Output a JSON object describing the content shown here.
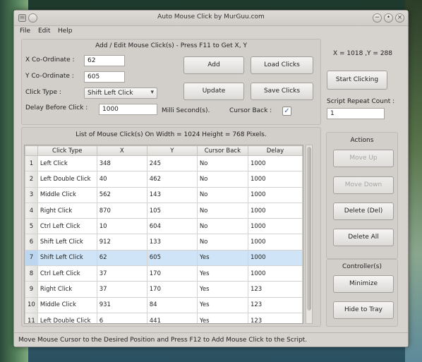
{
  "window": {
    "title": "Auto Mouse Click by MurGuu.com",
    "controls": [
      "−",
      "•",
      "×"
    ]
  },
  "menu": [
    "File",
    "Edit",
    "Help"
  ],
  "editor": {
    "heading": "Add / Edit Mouse Click(s) - Press F11 to Get X, Y",
    "x_label": "X Co-Ordinate :",
    "x_value": "62",
    "y_label": "Y Co-Ordinate :",
    "y_value": "605",
    "click_type_label": "Click Type :",
    "click_type_value": "Shift Left Click",
    "delay_label": "Delay Before Click :",
    "delay_value": "1000",
    "delay_unit": "Milli Second(s).",
    "cursor_back_label": "Cursor Back :",
    "cursor_back_checked": true,
    "buttons": {
      "add": "Add",
      "update": "Update",
      "load": "Load Clicks",
      "save": "Save Clicks"
    }
  },
  "right": {
    "coords": "X = 1018 ,Y = 288",
    "start": "Start Clicking",
    "repeat_label": "Script Repeat Count :",
    "repeat_value": "1"
  },
  "list": {
    "heading": "List of Mouse Click(s) On Width = 1024 Height = 768 Pixels.",
    "columns": [
      "Click Type",
      "X",
      "Y",
      "Cursor Back",
      "Delay"
    ],
    "selected_row": 7,
    "rows": [
      [
        "1",
        "Left Click",
        "348",
        "245",
        "No",
        "1000"
      ],
      [
        "2",
        "Left Double Click",
        "40",
        "462",
        "No",
        "1000"
      ],
      [
        "3",
        "Middle Click",
        "562",
        "143",
        "No",
        "1000"
      ],
      [
        "4",
        "Right Click",
        "870",
        "105",
        "No",
        "1000"
      ],
      [
        "5",
        "Ctrl Left Click",
        "10",
        "604",
        "No",
        "1000"
      ],
      [
        "6",
        "Shift Left Click",
        "912",
        "133",
        "No",
        "1000"
      ],
      [
        "7",
        "Shift Left Click",
        "62",
        "605",
        "Yes",
        "1000"
      ],
      [
        "8",
        "Ctrl Left Click",
        "37",
        "170",
        "Yes",
        "1000"
      ],
      [
        "9",
        "Right Click",
        "37",
        "170",
        "Yes",
        "123"
      ],
      [
        "10",
        "Middle Click",
        "931",
        "84",
        "Yes",
        "123"
      ],
      [
        "11",
        "Left Double Click",
        "6",
        "441",
        "Yes",
        "123"
      ]
    ]
  },
  "actions": {
    "title": "Actions",
    "move_up": "Move Up",
    "move_down": "Move Down",
    "delete": "Delete (Del)",
    "delete_all": "Delete All"
  },
  "controllers": {
    "title": "Controller(s)",
    "minimize": "Minimize",
    "hide": "Hide to Tray"
  },
  "status": "Move Mouse Cursor to the Desired Position and Press F12 to Add Mouse Click to the Script."
}
